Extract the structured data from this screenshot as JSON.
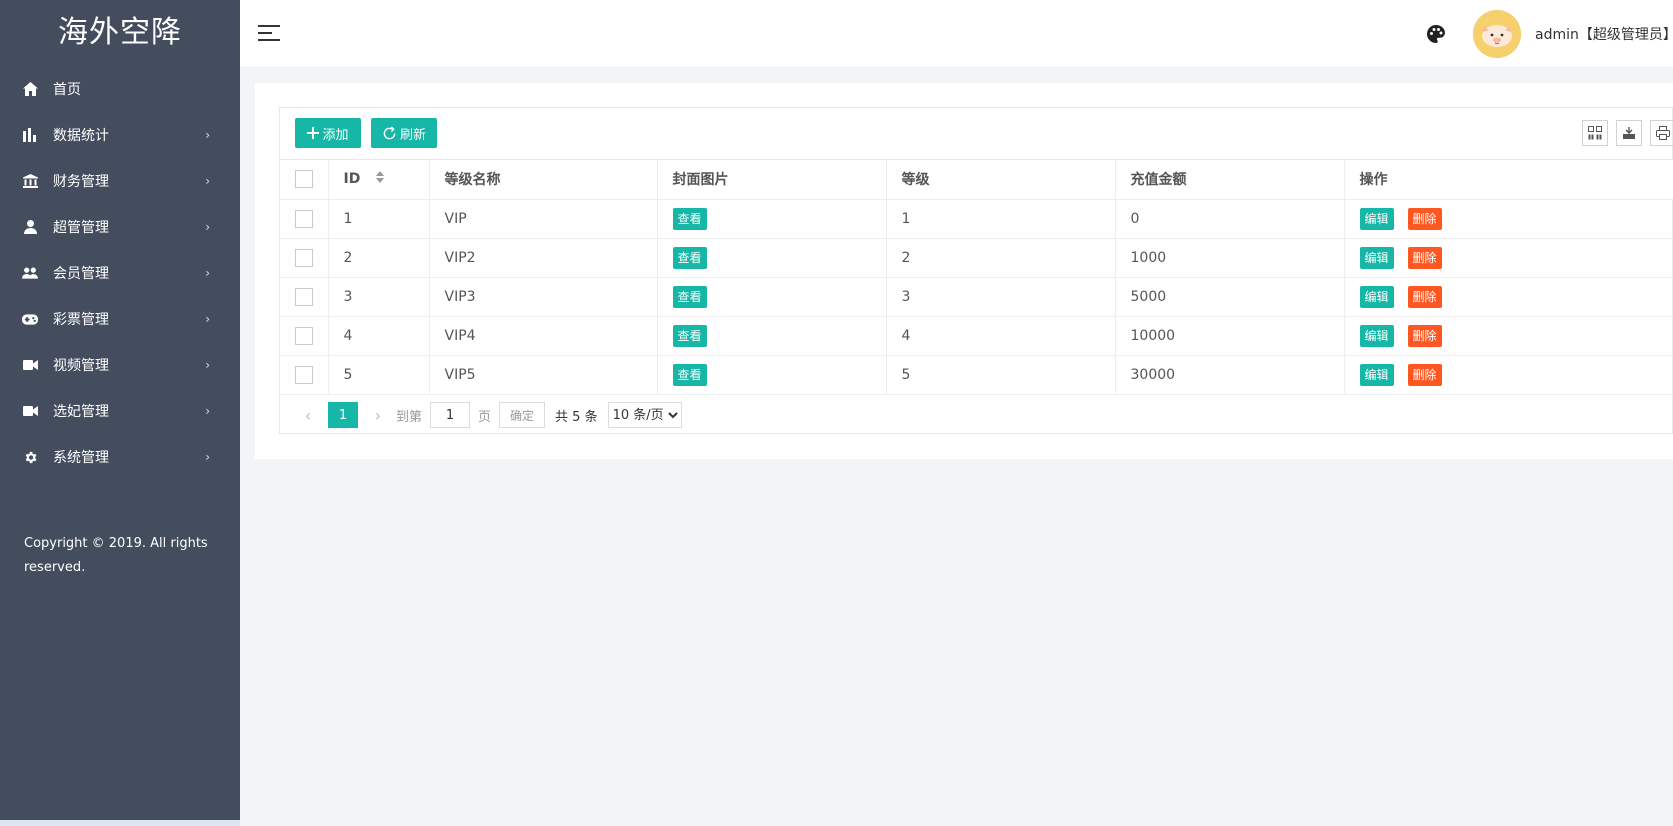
{
  "brand": "海外空降",
  "menu": [
    {
      "label": "首页",
      "icon": "home-icon",
      "has_arrow": false
    },
    {
      "label": "数据统计",
      "icon": "bar-chart-icon",
      "has_arrow": true
    },
    {
      "label": "财务管理",
      "icon": "bank-icon",
      "has_arrow": true
    },
    {
      "label": "超管管理",
      "icon": "user-icon",
      "has_arrow": true
    },
    {
      "label": "会员管理",
      "icon": "users-icon",
      "has_arrow": true
    },
    {
      "label": "彩票管理",
      "icon": "gamepad-icon",
      "has_arrow": true
    },
    {
      "label": "视频管理",
      "icon": "video-icon",
      "has_arrow": true
    },
    {
      "label": "选妃管理",
      "icon": "video-icon",
      "has_arrow": true
    },
    {
      "label": "系统管理",
      "icon": "gear-icon",
      "has_arrow": true
    }
  ],
  "menu_arrow": "›",
  "copyright": "Copyright © 2019. All rights reserved.",
  "header": {
    "user": "admin【超级管理员】"
  },
  "toolbar": {
    "add_label": "添加",
    "refresh_label": "刷新"
  },
  "table": {
    "columns": [
      "ID",
      "等级名称",
      "封面图片",
      "等级",
      "充值金额",
      "操作"
    ],
    "rows": [
      {
        "id": "1",
        "name": "VIP",
        "cover": "查看",
        "level": "1",
        "amount": "0"
      },
      {
        "id": "2",
        "name": "VIP2",
        "cover": "查看",
        "level": "2",
        "amount": "1000"
      },
      {
        "id": "3",
        "name": "VIP3",
        "cover": "查看",
        "level": "3",
        "amount": "5000"
      },
      {
        "id": "4",
        "name": "VIP4",
        "cover": "查看",
        "level": "4",
        "amount": "10000"
      },
      {
        "id": "5",
        "name": "VIP5",
        "cover": "查看",
        "level": "5",
        "amount": "30000"
      }
    ],
    "edit_label": "编辑",
    "delete_label": "删除"
  },
  "pager": {
    "current": "1",
    "goto_label": "到第",
    "goto_value": "1",
    "page_label": "页",
    "confirm_label": "确定",
    "total_label": "共 5 条",
    "per_page": "10 条/页"
  },
  "colors": {
    "sidebar": "#434d5e",
    "accent": "#16b7a6",
    "danger": "#ff5722"
  }
}
